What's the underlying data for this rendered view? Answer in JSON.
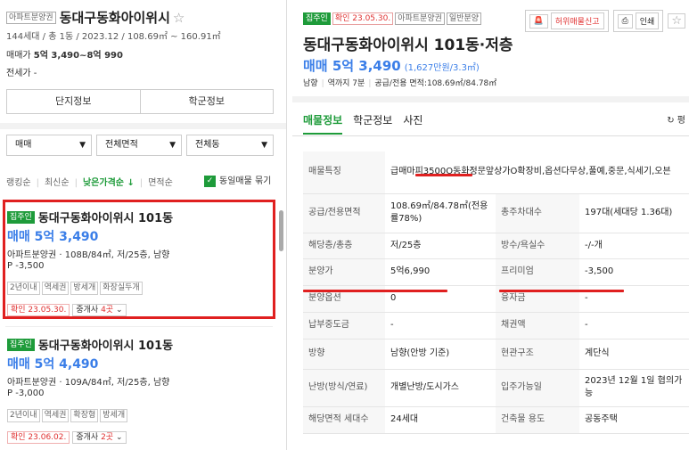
{
  "left": {
    "type_tag": "아파트분양권",
    "title": "동대구동화아이위시",
    "star": "☆",
    "subinfo": "144세대 / 총 1동 / 2023.12 / 108.69㎡ ~ 160.91㎡",
    "price_label": "매매가",
    "price_value": "5억 3,490~8억 990",
    "jeonse": "전세가 -",
    "tabs": [
      "단지정보",
      "학군정보"
    ],
    "filters": [
      "매매",
      "전체면적",
      "전체동"
    ],
    "sorts": [
      "랭킹순",
      "최신순",
      "낮은가격순 ↓",
      "면적순"
    ],
    "same_listing": "동일매물 묶기",
    "items": [
      {
        "badge": "집주인",
        "name": "동대구동화아이위시 101동",
        "price": "매매 5억 3,490",
        "type": "아파트분양권 · 108B/84㎡, 저/25층, 남향",
        "premium": "P -3,500",
        "keywords": [
          "2년이내",
          "역세권",
          "방세개",
          "화장실두개"
        ],
        "confirm": "확인 23.05.30.",
        "agents_prefix": "중개사 ",
        "agents_count": "4곳",
        "caret": "⌄"
      },
      {
        "badge": "집주인",
        "name": "동대구동화아이위시 101동",
        "price": "매매 5억 4,490",
        "type": "아파트분양권 · 109A/84㎡, 저/25층, 남향",
        "premium": "P -3,000",
        "keywords": [
          "2년이내",
          "역세권",
          "확장형",
          "방세개"
        ],
        "confirm": "확인 23.06.02.",
        "agents_prefix": "중개사 ",
        "agents_count": "2곳",
        "caret": "⌄"
      }
    ]
  },
  "right": {
    "tags": [
      "집주인",
      "확인 23.05.30.",
      "아파트분양권",
      "일반분양"
    ],
    "report_btn": "허위매물신고",
    "print_btn": "인쇄",
    "star": "☆",
    "title": "동대구동화아이위시 101동·저층",
    "price": "매매 5억 3,490",
    "price_per": "(1,627만원/3.3㎡)",
    "info": [
      "남향",
      "역까지 7분",
      "공급/전용 면적:108.69㎡/84.78㎡"
    ],
    "tabs": [
      "매물정보",
      "학군정보",
      "사진"
    ],
    "refresh": "평",
    "rows": [
      {
        "k": "매물특징",
        "v": "급매마피3500O동화정문앞상가O확장비,옵션다무상,풀예,중문,식세기,오븐",
        "span": true
      },
      {
        "k": "공급/전용면적",
        "v": "108.69㎡/84.78㎡(전용률78%)",
        "k2": "총주차대수",
        "v2": "197대(세대당 1.36대)"
      },
      {
        "k": "해당층/총층",
        "v": "저/25층",
        "k2": "방수/욕실수",
        "v2": "-/-개"
      },
      {
        "k": "분양가",
        "v": "5억6,990",
        "k2": "프리미엄",
        "v2": "-3,500"
      },
      {
        "k": "분양옵션",
        "v": "0",
        "k2": "융자금",
        "v2": "-"
      },
      {
        "k": "납부중도금",
        "v": "-",
        "k2": "채권액",
        "v2": "-"
      },
      {
        "k": "방향",
        "v": "남향(안방 기준)",
        "k2": "현관구조",
        "v2": "계단식"
      },
      {
        "k": "난방(방식/연료)",
        "v": "개별난방/도시가스",
        "k2": "입주가능일",
        "v2": "2023년 12월 1일 협의가능"
      },
      {
        "k": "해당면적 세대수",
        "v": "24세대",
        "k2": "건축물 용도",
        "v2": "공동주택"
      }
    ]
  },
  "colors": {
    "accent_green": "#1e9b3a",
    "price_blue": "#3a7ee8",
    "highlight_red": "#e02020"
  }
}
